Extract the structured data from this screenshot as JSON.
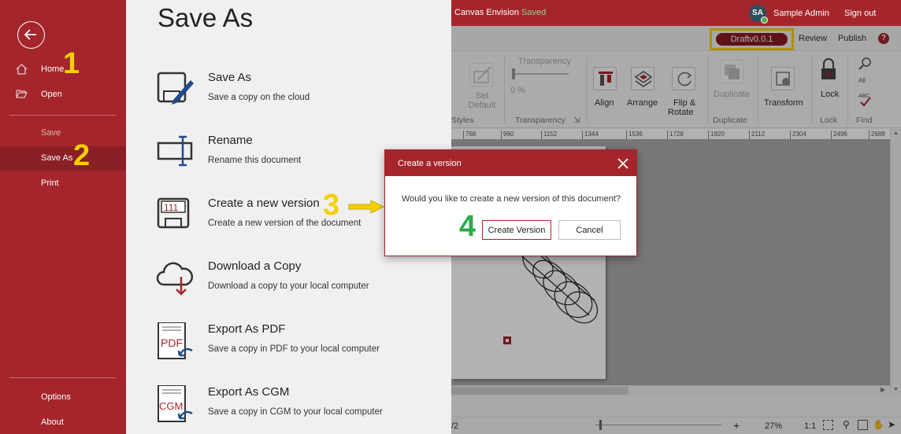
{
  "topbar": {
    "app_name": "Canvas Envision",
    "status": "Saved",
    "avatar_initials": "SA",
    "user_name": "Sample Admin",
    "signout_label": "Sign out"
  },
  "subbar": {
    "version_label": "Draftv0.0.1",
    "review_label": "Review",
    "publish_label": "Publish",
    "help_symbol": "?"
  },
  "ribbon": {
    "set_default_label": "Set Default",
    "transparency_title": "Transparency",
    "transparency_value": "0 %",
    "groups": {
      "styles": "Styles",
      "transparency": "Transparency",
      "duplicate": "Duplicate",
      "lock": "Lock",
      "find": "Find"
    },
    "buttons": {
      "align": "Align",
      "arrange": "Arrange",
      "flip_rotate_line1": "Flip &",
      "flip_rotate_line2": "Rotate",
      "duplicate": "Duplicate",
      "transform": "Transform",
      "lock": "Lock"
    }
  },
  "ruler": {
    "ticks": [
      "768",
      "960",
      "1152",
      "1344",
      "1536",
      "1728",
      "1920",
      "2112",
      "2304",
      "2496",
      "2688"
    ]
  },
  "statusbar": {
    "page_fragment": "/2",
    "zoom": "27%",
    "ratio": "1:1"
  },
  "sidebar": {
    "items": [
      {
        "label": "Home",
        "icon": "home-icon"
      },
      {
        "label": "Open",
        "icon": "folder-open-icon"
      },
      {
        "label": "Save"
      },
      {
        "label": "Save As"
      },
      {
        "label": "Print"
      },
      {
        "label": "Options"
      },
      {
        "label": "About"
      }
    ]
  },
  "panel": {
    "title": "Save As",
    "options": [
      {
        "title": "Save As",
        "desc": "Save a copy on the cloud",
        "icon": "save-as-icon"
      },
      {
        "title": "Rename",
        "desc": "Rename this document",
        "icon": "rename-icon"
      },
      {
        "title": "Create a new version",
        "desc": "Create a new version of the document",
        "icon": "version-icon",
        "icon_text": "111"
      },
      {
        "title": "Download a Copy",
        "desc": "Download a copy to your local computer",
        "icon": "cloud-download-icon"
      },
      {
        "title": "Export As PDF",
        "desc": "Save a copy in PDF to your local computer",
        "icon": "export-pdf-icon",
        "icon_text": "PDF"
      },
      {
        "title": "Export As CGM",
        "desc": "Save a copy in CGM to your local computer",
        "icon": "export-cgm-icon",
        "icon_text": "CGM"
      }
    ]
  },
  "dialog": {
    "title": "Create a version",
    "message": "Would you like to create a new version of this document?",
    "confirm_label": "Create Version",
    "cancel_label": "Cancel"
  },
  "annotations": {
    "step1": "1",
    "step2": "2",
    "step3": "3",
    "step4": "4",
    "highlight_color": "#f5d000",
    "step4_color": "#2daa4a"
  },
  "colors": {
    "brand": "#a4262c",
    "brand_dark": "#8a1f25",
    "panel_bg": "#f0f0f0"
  }
}
